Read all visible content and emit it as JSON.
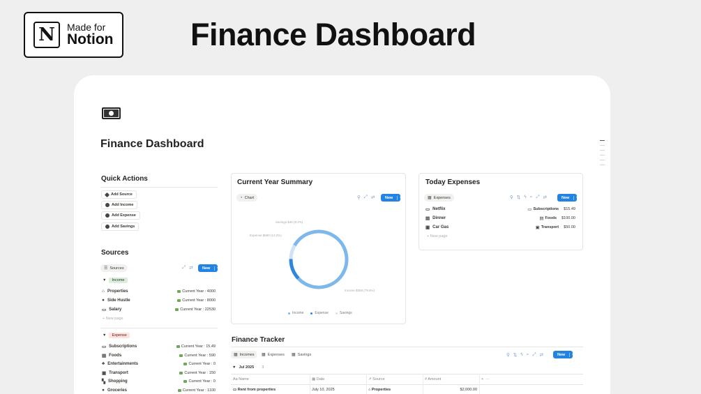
{
  "badge": {
    "logo": "N",
    "line1": "Made for",
    "line2": "Notion"
  },
  "headline": "Finance Dashboard",
  "page": {
    "icon": "money-icon",
    "title": "Finance Dashboard"
  },
  "quick_actions": {
    "title": "Quick Actions",
    "buttons": [
      "Add Source",
      "Add Income",
      "Add Expense",
      "Add Savings"
    ]
  },
  "sources": {
    "title": "Sources",
    "view_tab": "Sources",
    "new_label": "New",
    "income_group": {
      "label": "Income",
      "rows": [
        {
          "name": "Properties",
          "value": "Current Year : 4000"
        },
        {
          "name": "Side Hustle",
          "value": "Current Year : 8000"
        },
        {
          "name": "Salary",
          "value": "Current Year : 22530"
        }
      ],
      "new_page": "New page"
    },
    "expense_group": {
      "label": "Expense",
      "rows": [
        {
          "name": "Subscriptions",
          "value": "Current Year : 15.49"
        },
        {
          "name": "Foods",
          "value": "Current Year : 590"
        },
        {
          "name": "Entertainments",
          "value": "Current Year : 0"
        },
        {
          "name": "Transport",
          "value": "Current Year : 150"
        },
        {
          "name": "Shopping",
          "value": "Current Year : 0"
        },
        {
          "name": "Groceries",
          "value": "Current Year : 1100"
        }
      ]
    }
  },
  "summary": {
    "title": "Current Year Summary",
    "view_tab": "Chart",
    "new_label": "New",
    "labels": {
      "savings": "Savings $46 (8.2%)",
      "expense": "Expense $690 (12.2%)",
      "income": "Income $358 (79.6%)"
    },
    "legend": [
      "Income",
      "Expense",
      "Savings"
    ],
    "colors": {
      "income": "#7db8ea",
      "expense": "#2f86dc",
      "savings": "#cfe3f6"
    }
  },
  "chart_data": {
    "type": "pie",
    "title": "Current Year Summary",
    "categories": [
      "Income",
      "Expense",
      "Savings"
    ],
    "values": [
      79.6,
      12.2,
      8.2
    ],
    "legend": "bottom"
  },
  "today": {
    "title": "Today Expenses",
    "view_tab": "Expenses",
    "new_label": "New",
    "rows": [
      {
        "name": "Netflix",
        "category": "Subscriptions",
        "amount": "$15.49"
      },
      {
        "name": "Dinner",
        "category": "Foods",
        "amount": "$100.00"
      },
      {
        "name": "Car Gas",
        "category": "Transport",
        "amount": "$50.00"
      }
    ],
    "new_page": "New page"
  },
  "tracker": {
    "title": "Finance Tracker",
    "tabs": [
      "Incomes",
      "Expenses",
      "Savings"
    ],
    "new_label": "New",
    "group": "Jul 2025",
    "group_count": "3",
    "columns": [
      "Name",
      "Date",
      "Source",
      "Amount"
    ],
    "rows": [
      {
        "name": "Rent from properties",
        "date": "July 10, 2025",
        "source": "Properties",
        "amount": "$2,000.00"
      }
    ]
  }
}
